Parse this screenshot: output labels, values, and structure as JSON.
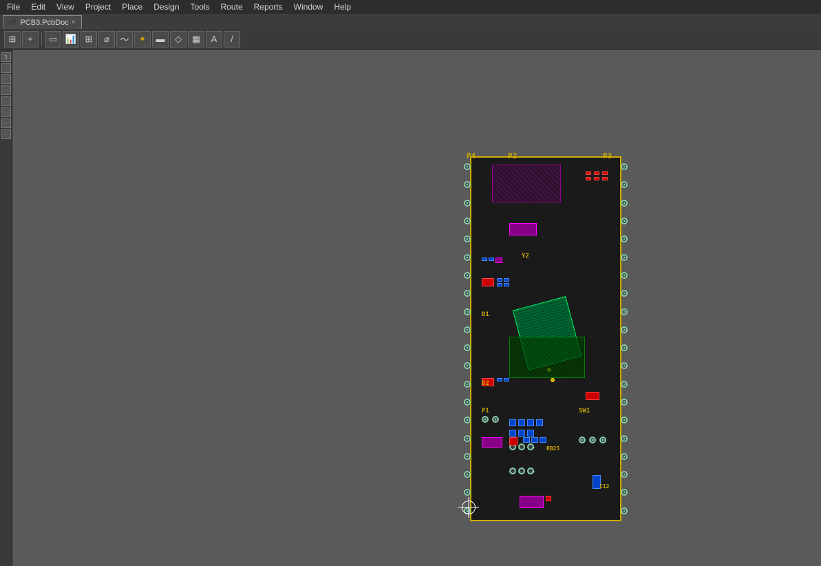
{
  "menubar": {
    "items": [
      "File",
      "Edit",
      "View",
      "Project",
      "Place",
      "Design",
      "Tools",
      "Route",
      "Reports",
      "Window",
      "Help"
    ]
  },
  "tab": {
    "label": "PCB3.PcbDoc",
    "close": "×"
  },
  "toolbar": {
    "buttons": [
      {
        "name": "filter-btn",
        "icon": "⊞",
        "label": "Filter"
      },
      {
        "name": "add-btn",
        "icon": "+",
        "label": "Add"
      },
      {
        "name": "select-rect-btn",
        "icon": "▭",
        "label": "Select Rectangle"
      },
      {
        "name": "chart-btn",
        "icon": "▦",
        "label": "Chart"
      },
      {
        "name": "grid-btn",
        "icon": "⊞",
        "label": "Grid"
      },
      {
        "name": "route-btn",
        "icon": "⌀",
        "label": "Route"
      },
      {
        "name": "wave-btn",
        "icon": "〜",
        "label": "Wave"
      },
      {
        "name": "star-btn",
        "icon": "✦",
        "label": "Star"
      },
      {
        "name": "pad-btn",
        "icon": "▬",
        "label": "Pad"
      },
      {
        "name": "poly-btn",
        "icon": "◇",
        "label": "Polygon"
      },
      {
        "name": "bar-btn",
        "icon": "▦",
        "label": "Bar"
      },
      {
        "name": "text-btn",
        "icon": "A",
        "label": "Text"
      },
      {
        "name": "pen-btn",
        "icon": "/",
        "label": "Pen"
      }
    ]
  },
  "pcb": {
    "labels": {
      "P4": "P4",
      "P2": "P2",
      "P3": "P3",
      "Y2": "Y2",
      "D1": "D1",
      "D2": "D2",
      "P1": "P1",
      "SW1": "SW1",
      "RB25": "RB25",
      "C12": "C12"
    },
    "board_color": "#1a1a1a",
    "border_color": "#ccaa00"
  }
}
